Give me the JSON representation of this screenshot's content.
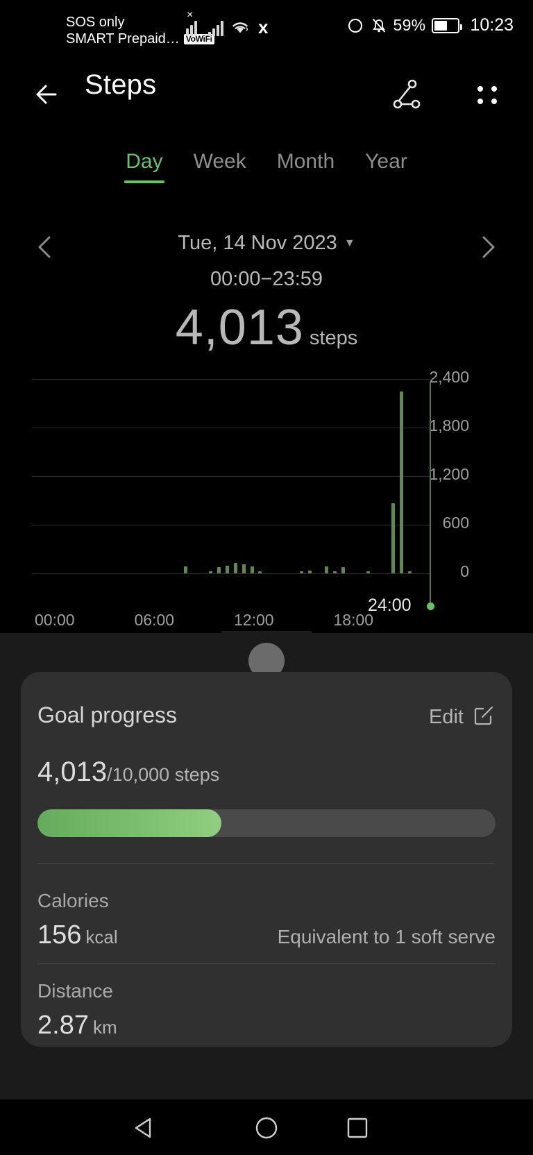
{
  "status_bar": {
    "carrier_line1": "SOS only",
    "carrier_line2": "SMART Prepaid…",
    "vowifi_badge": "VoWiFi",
    "battery_percent": "59%",
    "clock": "10:23",
    "icons": [
      "signal-no-service-icon",
      "signal-bars-icon",
      "wifi-icon",
      "x-app-icon",
      "eye-comfort-icon",
      "mute-bell-icon",
      "battery-icon"
    ]
  },
  "app_bar": {
    "title": "Steps",
    "back_icon": "arrow-left-icon",
    "share_icon": "share-nodes-icon",
    "more_icon": "more-options-icon"
  },
  "tabs": [
    {
      "label": "Day",
      "active": true
    },
    {
      "label": "Week",
      "active": false
    },
    {
      "label": "Month",
      "active": false
    },
    {
      "label": "Year",
      "active": false
    }
  ],
  "date_nav": {
    "prev_icon": "chevron-left-icon",
    "next_icon": "chevron-right-icon",
    "date": "Tue, 14 Nov 2023",
    "caret": "▼",
    "time_range": "00:00−23:59"
  },
  "summary": {
    "total": "4,013",
    "unit": "steps"
  },
  "chart_data": {
    "type": "bar",
    "title": "Steps by time of day",
    "xlabel": "",
    "ylabel": "steps",
    "ylim": [
      0,
      2400
    ],
    "yticks": [
      0,
      600,
      1200,
      1800,
      2400
    ],
    "ytick_labels": [
      "0",
      "600",
      "1,200",
      "1,800",
      "2,400"
    ],
    "x_tick_labels": [
      "00:00",
      "06:00",
      "12:00",
      "18:00"
    ],
    "x_tick_hours": [
      0,
      6,
      12,
      18
    ],
    "grid": true,
    "legend": "none",
    "bar_color": "#5f8a4f",
    "marker_label": "24:00",
    "marker_hour": 24,
    "categories": [
      "00:00",
      "00:30",
      "01:00",
      "01:30",
      "02:00",
      "02:30",
      "03:00",
      "03:30",
      "04:00",
      "04:30",
      "05:00",
      "05:30",
      "06:00",
      "06:30",
      "07:00",
      "07:30",
      "08:00",
      "08:30",
      "09:00",
      "09:30",
      "10:00",
      "10:30",
      "11:00",
      "11:30",
      "12:00",
      "12:30",
      "13:00",
      "13:30",
      "14:00",
      "14:30",
      "15:00",
      "15:30",
      "16:00",
      "16:30",
      "17:00",
      "17:30",
      "18:00",
      "18:30",
      "19:00",
      "19:30",
      "20:00",
      "20:30",
      "21:00",
      "21:30",
      "22:00",
      "22:30",
      "23:00",
      "23:30"
    ],
    "values": [
      0,
      0,
      0,
      0,
      0,
      0,
      0,
      0,
      0,
      0,
      0,
      0,
      0,
      0,
      0,
      0,
      0,
      0,
      90,
      0,
      0,
      25,
      75,
      95,
      130,
      110,
      85,
      20,
      0,
      0,
      0,
      0,
      30,
      35,
      0,
      85,
      25,
      80,
      0,
      0,
      20,
      0,
      0,
      870,
      2250,
      30,
      0,
      0
    ]
  },
  "sheet": {
    "goal_card": {
      "title": "Goal progress",
      "edit_label": "Edit",
      "edit_icon": "edit-square-icon",
      "current": "4,013",
      "target_text": "/10,000 steps",
      "progress_percent": 40.1,
      "fill_color": "#7cc46f",
      "track_color": "#4a4a4a"
    },
    "metrics": [
      {
        "label": "Calories",
        "value": "156",
        "unit": "kcal",
        "note": "Equivalent to 1 soft serve"
      },
      {
        "label": "Distance",
        "value": "2.87",
        "unit": "km",
        "note": ""
      }
    ]
  },
  "nav_bar": {
    "back_icon": "nav-back-triangle-icon",
    "home_icon": "nav-home-circle-icon",
    "recent_icon": "nav-recents-square-icon"
  }
}
